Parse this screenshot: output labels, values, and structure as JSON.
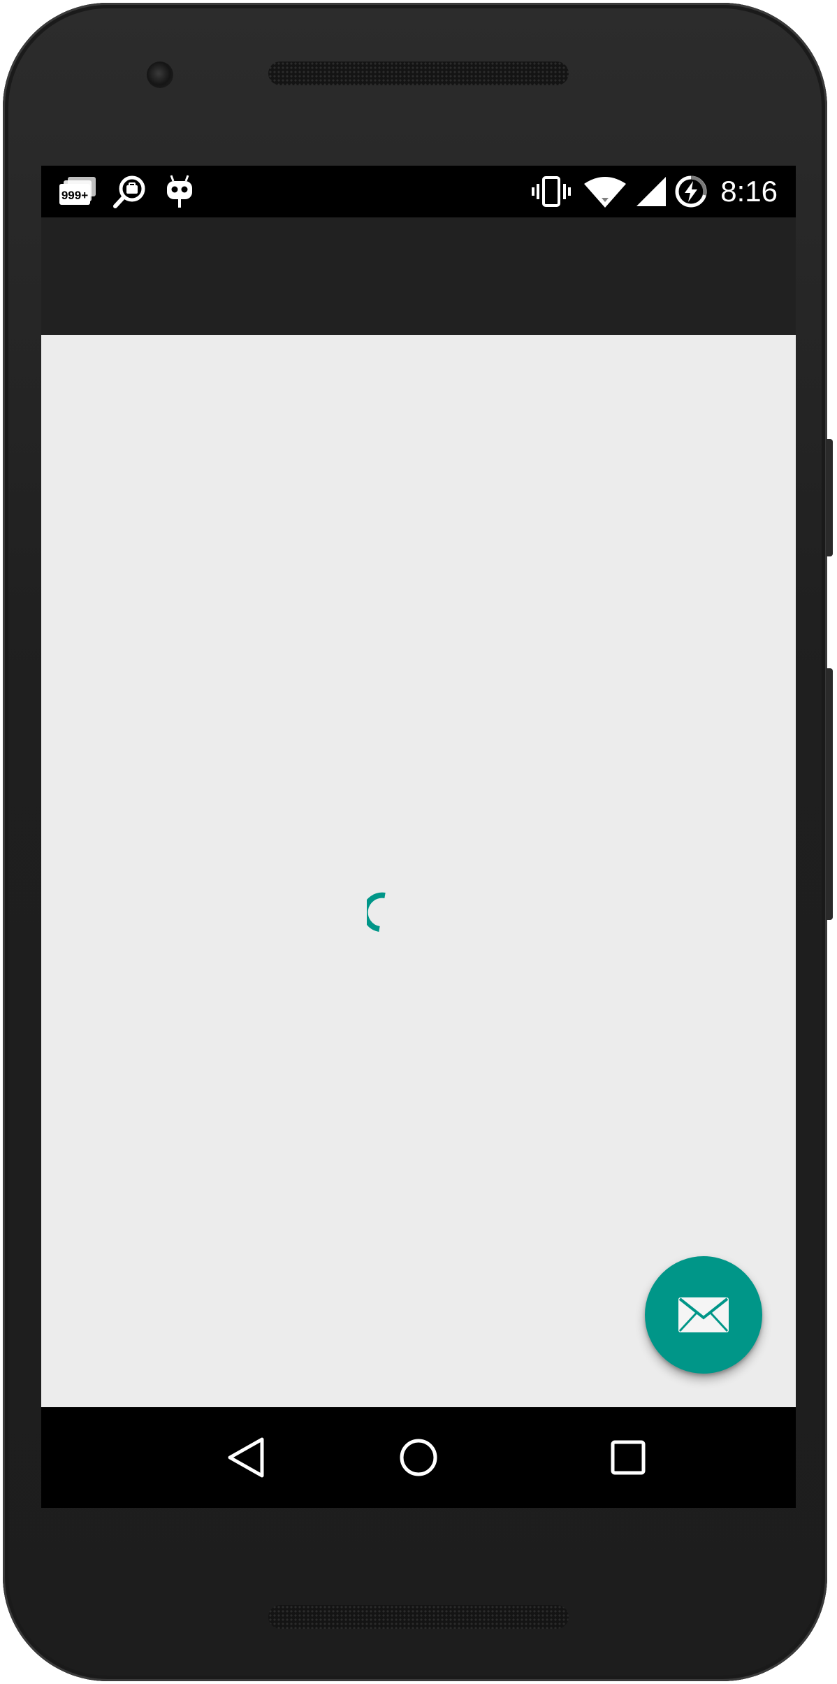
{
  "status_bar": {
    "time": "8:16",
    "notification_count_label": "999+",
    "icons": [
      "notifications-stack-icon",
      "search-work-icon",
      "robot-icon",
      "vibrate-icon",
      "wifi-icon",
      "cell-signal-icon",
      "battery-charging-icon"
    ]
  },
  "content": {
    "loading": true
  },
  "fab": {
    "icon": "mail-icon",
    "color": "#009688"
  },
  "nav_bar": {
    "buttons": [
      "back-icon",
      "home-icon",
      "recents-icon"
    ]
  },
  "colors": {
    "accent": "#009688",
    "toolbar": "#212121",
    "background": "#ececec",
    "status_bar": "#000000"
  }
}
